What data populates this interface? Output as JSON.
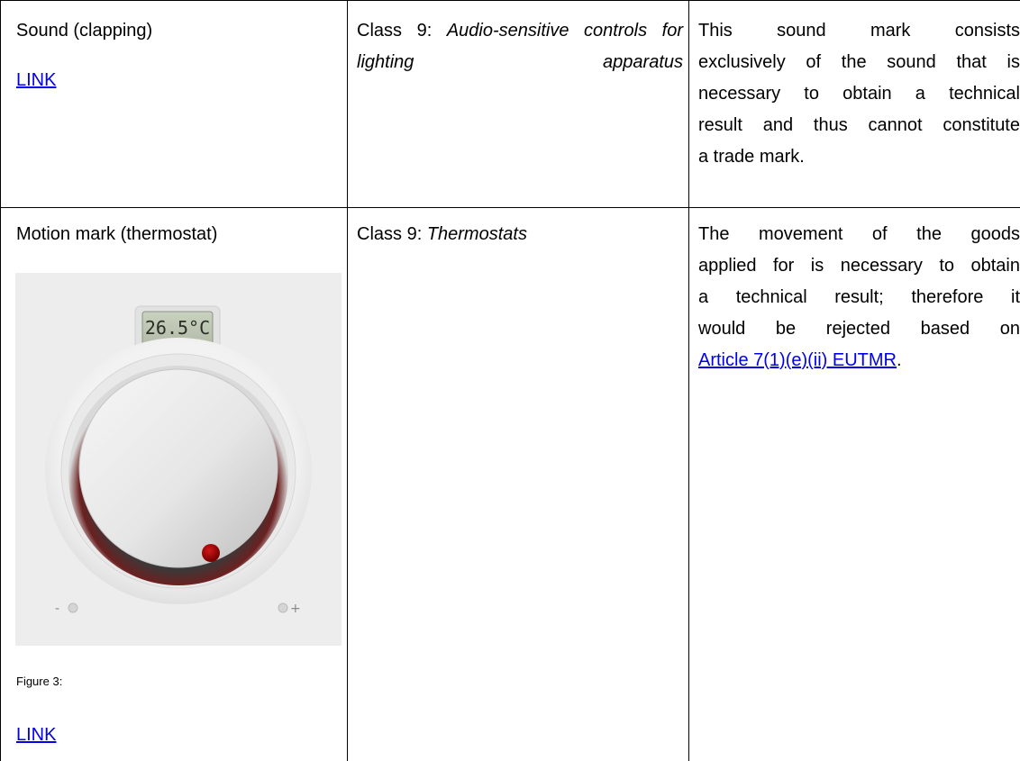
{
  "rows": [
    {
      "type_label": "Sound (clapping)",
      "link_label": "LINK",
      "class_prefix": "Class 9: ",
      "class_goods": "Audio-sensitive controls for lighting apparatus",
      "comment_lines": [
        "This sound mark consists",
        "exclusively of the sound that is",
        "necessary to obtain a technical",
        "result and thus cannot constitute",
        "a trade mark."
      ]
    },
    {
      "type_label": "Motion mark (thermostat)",
      "thermostat_display": "26.5°C",
      "thermostat_minus": "-",
      "thermostat_plus": "+",
      "figure_caption": "Figure 3:",
      "link_label": "LINK",
      "class_prefix": "Class 9: ",
      "class_goods": "Thermostats",
      "comment_lines": [
        "The movement of the goods",
        "applied for is necessary to obtain",
        "a technical result; therefore it",
        "would be rejected based on"
      ],
      "comment_link": "Article 7(1)(e)(ii) EUTMR",
      "comment_end": "."
    }
  ],
  "colors": {
    "link": "#0000ee",
    "knob_dot": "#a00000"
  }
}
